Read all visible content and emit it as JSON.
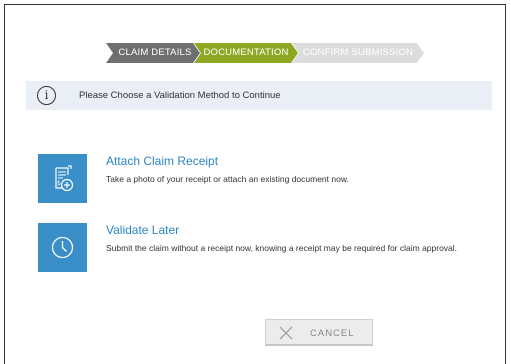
{
  "steps": [
    {
      "label": "CLAIM DETAILS",
      "state": "completed",
      "color": "#6d6f70"
    },
    {
      "label": "DOCUMENTATION",
      "state": "active",
      "color": "#8fa823"
    },
    {
      "label": "CONFIRM SUBMISSION",
      "state": "pending",
      "color": "#dcdcdc"
    }
  ],
  "info": {
    "icon": "info-icon",
    "text": "Please Choose a Validation Method to Continue"
  },
  "options": [
    {
      "icon": "receipt-add-icon",
      "title": "Attach Claim Receipt",
      "description": "Take a photo of your receipt or attach an existing document now."
    },
    {
      "icon": "clock-icon",
      "title": "Validate Later",
      "description": "Submit the claim without a receipt now, knowing a receipt may be required for claim approval."
    }
  ],
  "cancel": {
    "label": "CANCEL",
    "icon": "close-icon"
  },
  "colors": {
    "accent": "#3a8fc9",
    "link": "#2b86c4",
    "active_step": "#8fa823",
    "info_bg": "#e9eff5"
  }
}
